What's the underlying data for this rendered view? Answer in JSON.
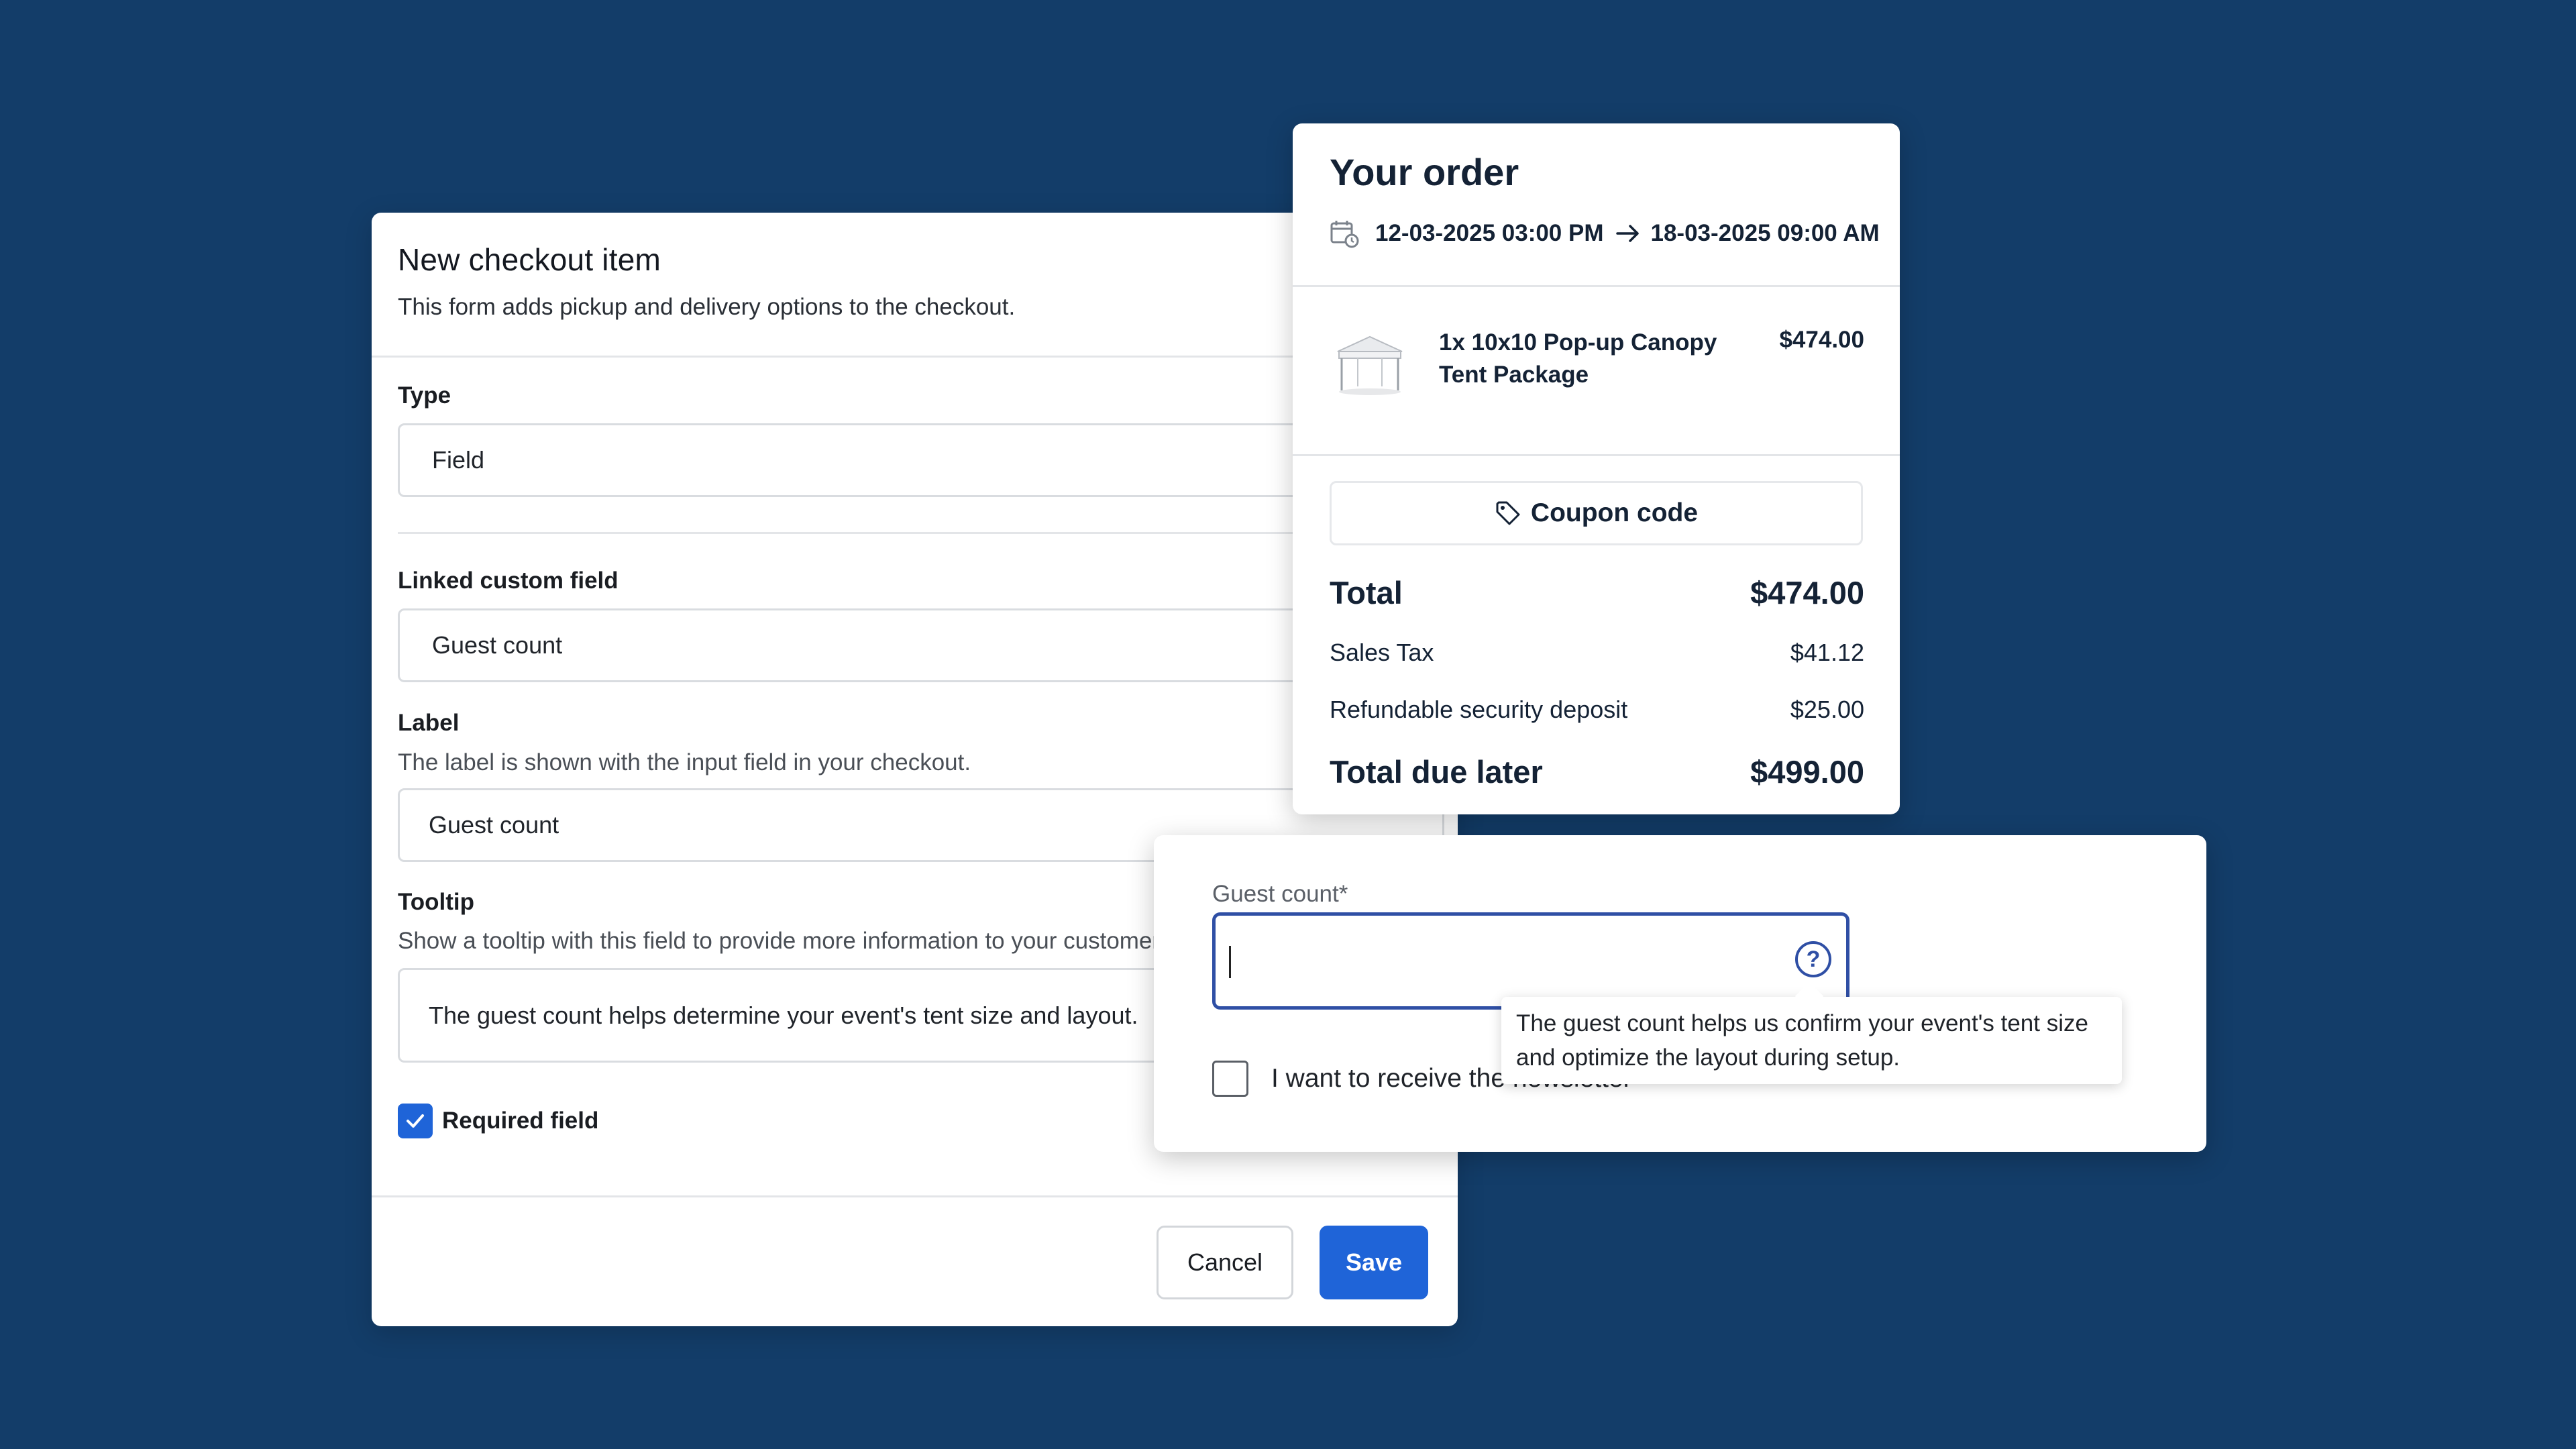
{
  "checkout_form": {
    "title": "New checkout item",
    "subtitle": "This form adds pickup and delivery options to the checkout.",
    "type_label": "Type",
    "type_value": "Field",
    "linked_label": "Linked custom field",
    "linked_value": "Guest count",
    "label_label": "Label",
    "label_help": "The label is shown with the input field in your checkout.",
    "label_value": "Guest count",
    "tooltip_label": "Tooltip",
    "tooltip_help": "Show a tooltip with this field to provide more information to your customer.",
    "tooltip_value": "The guest count helps determine your event's tent size and layout.",
    "required_label": "Required field",
    "required_checked": true,
    "cancel_label": "Cancel",
    "save_label": "Save",
    "accent_color": "#1f64d8"
  },
  "order": {
    "title": "Your order",
    "start": "12-03-2025 03:00 PM",
    "end": "18-03-2025 09:00 AM",
    "item_name": "1x 10x10 Pop-up Canopy Tent Package",
    "item_price": "$474.00",
    "coupon_label": "Coupon code",
    "total_label": "Total",
    "total_value": "$474.00",
    "tax_label": "Sales Tax",
    "tax_value": "$41.12",
    "deposit_label": "Refundable security deposit",
    "deposit_value": "$25.00",
    "due_label": "Total due later",
    "due_value": "$499.00"
  },
  "preview": {
    "field_label": "Guest count*",
    "input_value": "",
    "help_icon": "question-circle-icon",
    "newsletter_label": "I want to receive the newsletter",
    "newsletter_checked": false,
    "tooltip_text": "The guest count helps us confirm your event's tent size and optimize the layout during setup."
  },
  "colors": {
    "background": "#133d69",
    "focus_border": "#2f4fa5"
  }
}
